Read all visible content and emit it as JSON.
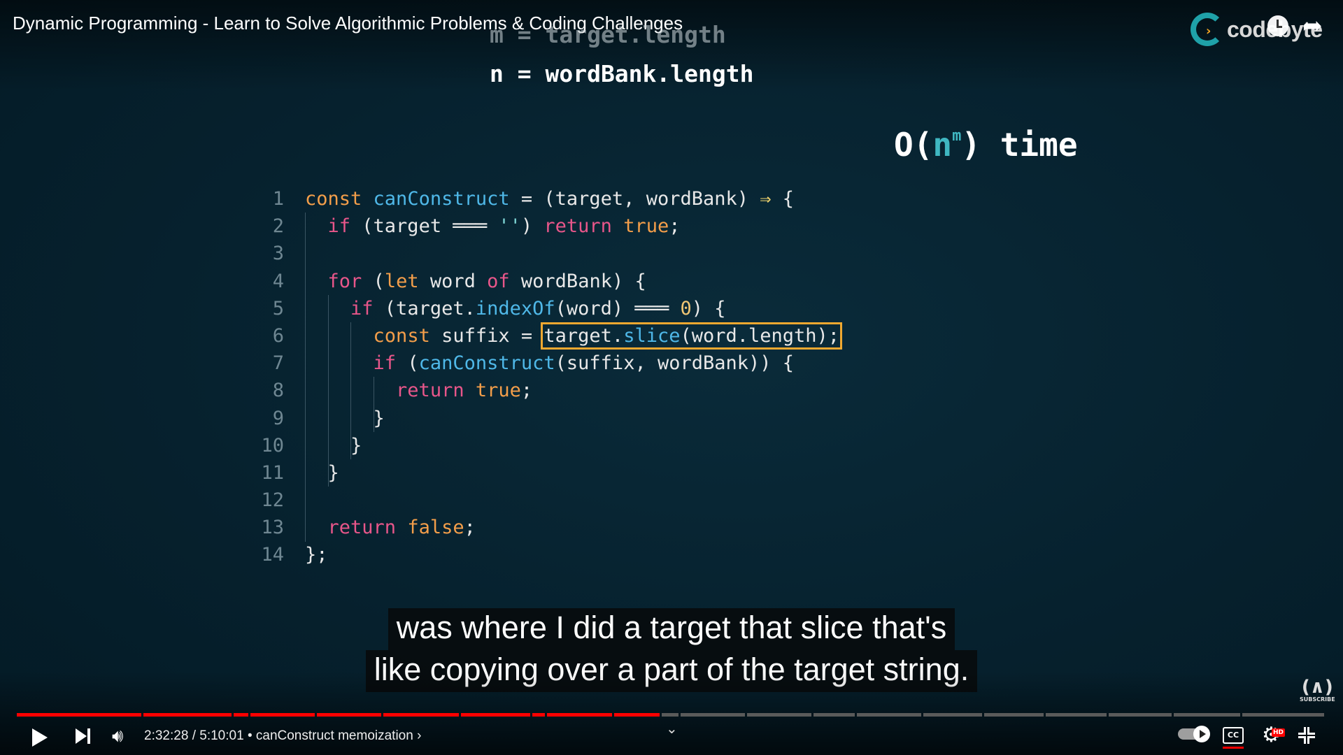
{
  "video": {
    "title": "Dynamic Programming - Learn to Solve Algorithmic Problems & Coding Challenges",
    "channel_logo_text": "codebyte"
  },
  "slide": {
    "var_m": "m = target.length",
    "var_n": "n = wordBank.length",
    "complexity": {
      "prefix": "O(",
      "base": "n",
      "exponent": "m",
      "suffix": ") time"
    },
    "code_lines": [
      {
        "num": "1",
        "text": "const canConstruct = (target, wordBank) ⇒ {"
      },
      {
        "num": "2",
        "text": "if (target ═══ '') return true;"
      },
      {
        "num": "3",
        "text": ""
      },
      {
        "num": "4",
        "text": "for (let word of wordBank) {"
      },
      {
        "num": "5",
        "text": "if (target.indexOf(word) ═══ 0) {"
      },
      {
        "num": "6",
        "text": "const suffix = target.slice(word.length);"
      },
      {
        "num": "7",
        "text": "if (canConstruct(suffix, wordBank)) {"
      },
      {
        "num": "8",
        "text": "return true;"
      },
      {
        "num": "9",
        "text": "}"
      },
      {
        "num": "10",
        "text": "}"
      },
      {
        "num": "11",
        "text": "}"
      },
      {
        "num": "12",
        "text": ""
      },
      {
        "num": "13",
        "text": "return false;"
      },
      {
        "num": "14",
        "text": "};"
      }
    ],
    "highlighted_expression": "target.slice(word.length);"
  },
  "captions": [
    "was where I did a target that slice that's",
    "like copying over a part of the target string."
  ],
  "player": {
    "current_time": "2:32:28",
    "duration": "5:10:01",
    "time_separator": "/",
    "chapter_separator": "•",
    "chapter": "canConstruct memoization",
    "chapter_chevron": "›",
    "progress_played_fraction": 0.4926,
    "hd_label": "HD",
    "cc_label": "CC",
    "subscribe_label": "SUBSCRIBE",
    "colors": {
      "played": "#ff0000",
      "buffered": "#9e9e9e",
      "unplayed": "#5a5a5a"
    },
    "icons": [
      "play-icon",
      "next-icon",
      "volume-icon",
      "chevron-down-icon",
      "autoplay-toggle",
      "cc-icon",
      "settings-icon",
      "fullscreen-exit-icon",
      "clock-icon",
      "share-icon"
    ]
  }
}
